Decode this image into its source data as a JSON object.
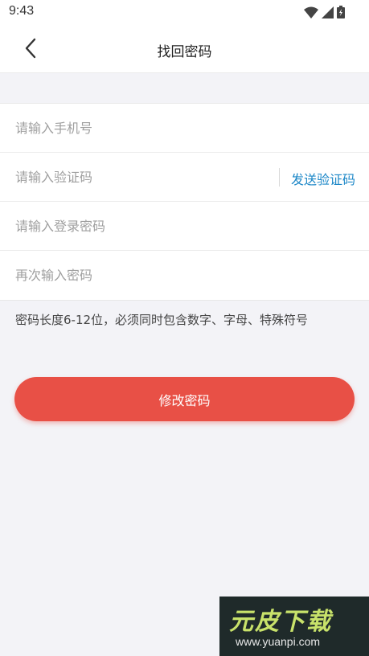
{
  "status_bar": {
    "time": "9:43",
    "icons": [
      "wifi-icon",
      "signal-icon",
      "battery-icon"
    ]
  },
  "header": {
    "back_icon": "chevron-left-icon",
    "title": "找回密码"
  },
  "form": {
    "phone_placeholder": "请输入手机号",
    "code_placeholder": "请输入验证码",
    "send_code_label": "发送验证码",
    "password_placeholder": "请输入登录密码",
    "confirm_placeholder": "再次输入密码"
  },
  "hint": "密码长度6-12位，必须同时包含数字、字母、特殊符号",
  "submit_label": "修改密码",
  "watermark": {
    "title": "元皮下载",
    "url": "www.yuanpi.com"
  },
  "colors": {
    "accent": "#e85046",
    "link": "#1e88c8",
    "background": "#f3f3f7"
  }
}
